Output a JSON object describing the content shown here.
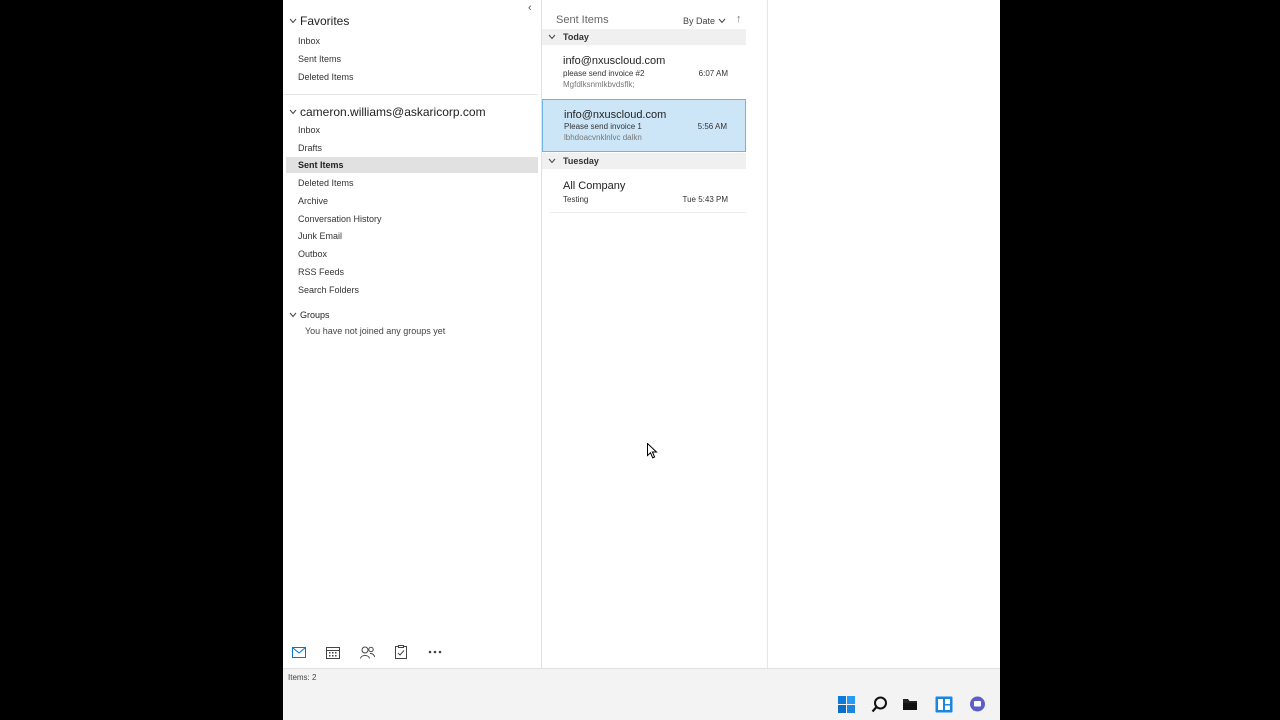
{
  "folder_pane": {
    "collapse_glyph": "‹",
    "favorites": {
      "label": "Favorites",
      "items": [
        "Inbox",
        "Sent Items",
        "Deleted Items"
      ]
    },
    "account": {
      "label": "cameron.williams@askaricorp.com",
      "items": [
        "Inbox",
        "Drafts",
        "Sent Items",
        "Deleted Items",
        "Archive",
        "Conversation History",
        "Junk Email",
        "Outbox",
        "RSS Feeds",
        "Search Folders"
      ],
      "selected": "Sent Items"
    },
    "groups": {
      "label": "Groups",
      "empty_message": "You have not joined any groups yet"
    }
  },
  "nav_bar": {
    "icons": [
      "mail-icon",
      "calendar-icon",
      "people-icon",
      "tasks-icon",
      "more-icon"
    ]
  },
  "message_list": {
    "title": "Sent Items",
    "sort_label": "By Date",
    "sort_direction_glyph": "↑",
    "groups": [
      {
        "label": "Today",
        "messages": [
          {
            "sender": "info@nxuscloud.com",
            "subject": "please send invoice #2",
            "preview": "Mgfdlksnmlkbvdsflk;",
            "time": "6:07 AM",
            "selected": false
          },
          {
            "sender": "info@nxuscloud.com",
            "subject": "Please send invoice 1",
            "preview": "lbhdoacvnklnlvc dalkn",
            "time": "5:56 AM",
            "selected": true
          }
        ]
      },
      {
        "label": "Tuesday",
        "messages": [
          {
            "sender": "All Company",
            "subject": "Testing",
            "preview": "",
            "time": "Tue 5:43 PM",
            "selected": false
          }
        ]
      }
    ]
  },
  "status_bar": {
    "text": "Items: 2"
  },
  "taskbar": {
    "icons": [
      "windows-start-icon",
      "search-icon",
      "file-explorer-icon",
      "widgets-icon",
      "chat-icon"
    ]
  },
  "colors": {
    "selected_message_bg": "#cde6f7",
    "selected_message_border": "#6fb4e4",
    "accent": "#0078d4",
    "selected_folder_bg": "#e1e1e1"
  }
}
